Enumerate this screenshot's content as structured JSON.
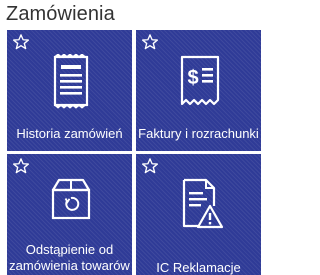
{
  "page": {
    "title": "Zamówienia"
  },
  "tiles": [
    {
      "label": "Historia zamówień",
      "icon": "order-history-document-icon",
      "favorite_icon": "star-outline-icon"
    },
    {
      "label": "Faktury i rozrachunki",
      "icon": "invoice-dollar-receipt-icon",
      "favorite_icon": "star-outline-icon"
    },
    {
      "label_line1": "Odstąpienie od",
      "label_line2": "zamówienia towarów",
      "icon": "return-box-icon",
      "favorite_icon": "star-outline-icon"
    },
    {
      "label": "IC Reklamacje",
      "icon": "complaint-warning-document-icon",
      "favorite_icon": "star-outline-icon"
    }
  ],
  "colors": {
    "tile_background": "#2f3b97",
    "tile_foreground": "#ffffff",
    "title_text": "#333333"
  }
}
